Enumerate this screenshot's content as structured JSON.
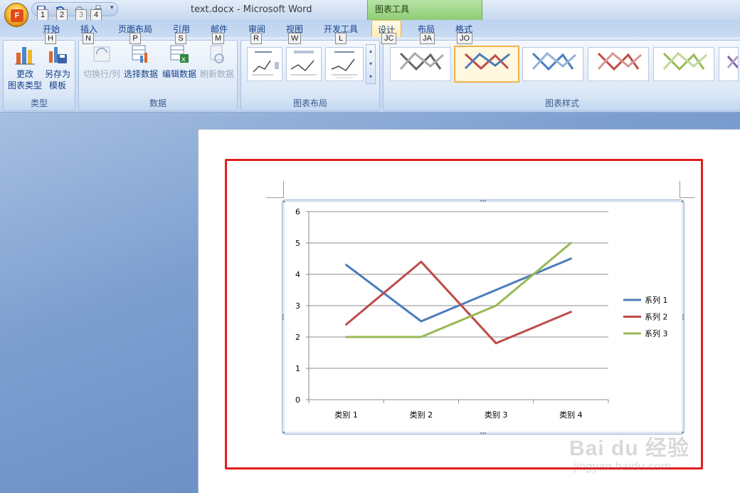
{
  "window": {
    "title": "text.docx - Microsoft Word",
    "context_tab_group": "图表工具"
  },
  "office_button": {
    "letter": "F"
  },
  "qat_keytips": [
    "1",
    "2",
    "3",
    "4"
  ],
  "tabs": [
    {
      "label": "开始",
      "keytip": "H"
    },
    {
      "label": "插入",
      "keytip": "N"
    },
    {
      "label": "页面布局",
      "keytip": "P"
    },
    {
      "label": "引用",
      "keytip": "S"
    },
    {
      "label": "邮件",
      "keytip": "M"
    },
    {
      "label": "审阅",
      "keytip": "R"
    },
    {
      "label": "视图",
      "keytip": "W"
    },
    {
      "label": "开发工具",
      "keytip": "L"
    },
    {
      "label": "设计",
      "keytip": "JC",
      "active": true
    },
    {
      "label": "布局",
      "keytip": "JA"
    },
    {
      "label": "格式",
      "keytip": "JO"
    }
  ],
  "ribbon": {
    "type_group": {
      "label": "类型",
      "change_type": [
        "更改",
        "图表类型"
      ],
      "save_template": [
        "另存为",
        "模板"
      ]
    },
    "data_group": {
      "label": "数据",
      "switch_row_col": "切换行/列",
      "select_data": "选择数据",
      "edit_data": "编辑数据",
      "refresh_data": "刷新数据"
    },
    "layout_group": {
      "label": "图表布局"
    },
    "style_group": {
      "label": "图表样式"
    }
  },
  "colors": {
    "series1": "#4a7ebb",
    "series2": "#be4b48",
    "series3": "#98b954",
    "highlight": "#e01e1e"
  },
  "chart_data": {
    "type": "line",
    "categories": [
      "类别 1",
      "类别 2",
      "类别 3",
      "类别 4"
    ],
    "series": [
      {
        "name": "系列 1",
        "values": [
          4.3,
          2.5,
          3.5,
          4.5
        ]
      },
      {
        "name": "系列 2",
        "values": [
          2.4,
          4.4,
          1.8,
          2.8
        ]
      },
      {
        "name": "系列 3",
        "values": [
          2.0,
          2.0,
          3.0,
          5.0
        ]
      }
    ],
    "yticks": [
      "0",
      "1",
      "2",
      "3",
      "4",
      "5",
      "6"
    ],
    "ylim": [
      0,
      6
    ],
    "grid": true,
    "legend": "right"
  },
  "watermark": {
    "main": "Bai du 经验",
    "url": "jingyan.baidu.com"
  }
}
